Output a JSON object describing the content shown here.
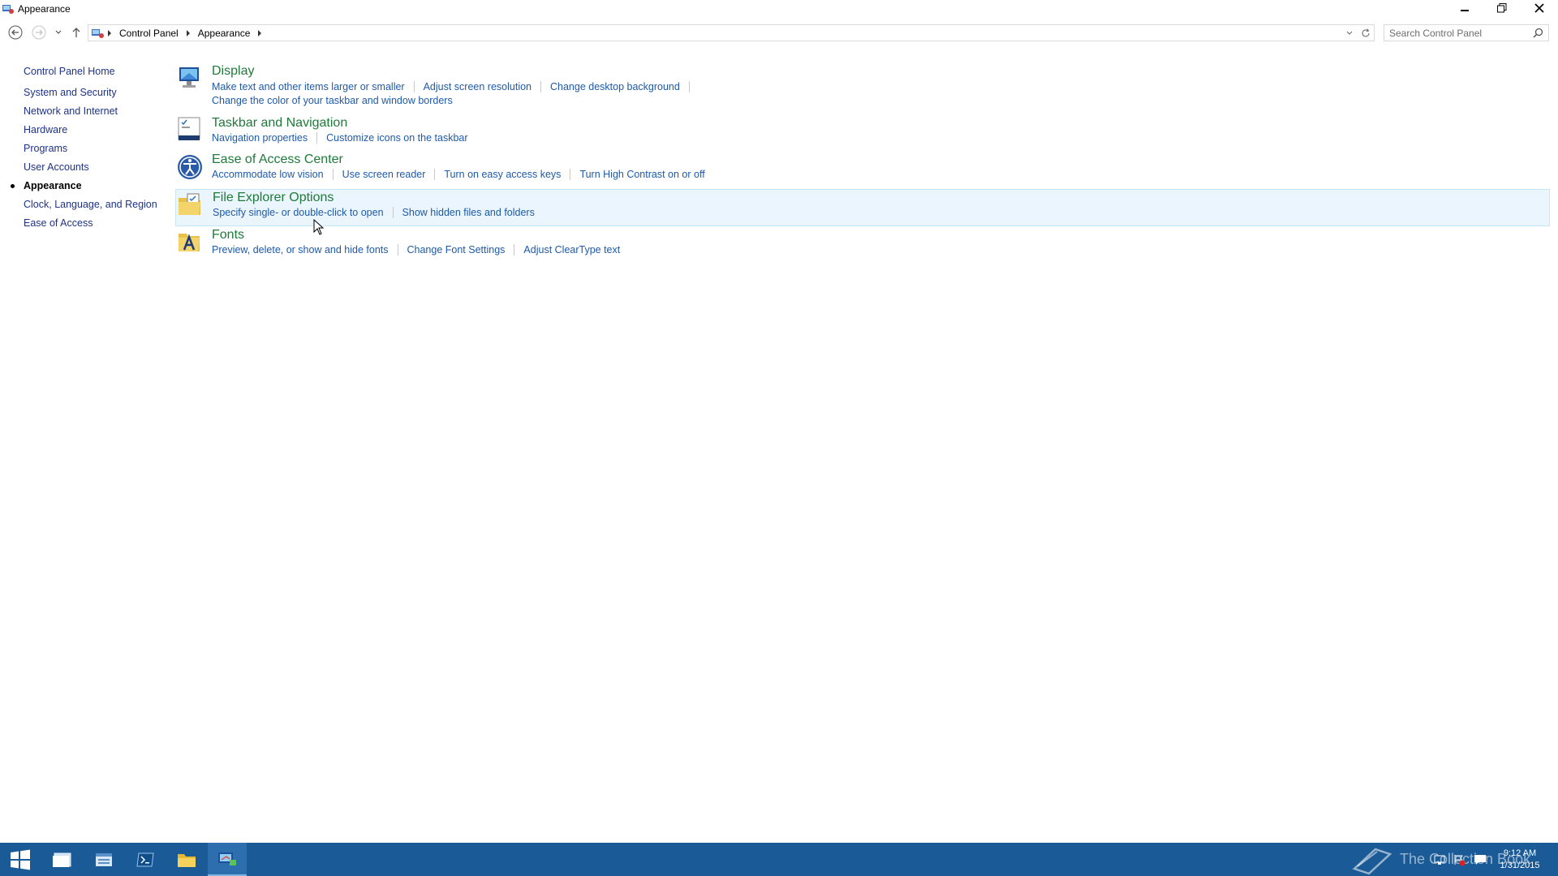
{
  "window": {
    "title": "Appearance",
    "minimize_icon": "minimize-icon",
    "restore_icon": "restore-icon",
    "close_icon": "close-icon"
  },
  "address": {
    "breadcrumbs": [
      "Control Panel",
      "Appearance"
    ],
    "search_placeholder": "Search Control Panel"
  },
  "sidebar": {
    "home": "Control Panel Home",
    "items": [
      {
        "label": "System and Security"
      },
      {
        "label": "Network and Internet"
      },
      {
        "label": "Hardware"
      },
      {
        "label": "Programs"
      },
      {
        "label": "User Accounts"
      },
      {
        "label": "Appearance",
        "active": true
      },
      {
        "label": "Clock, Language, and Region"
      },
      {
        "label": "Ease of Access"
      }
    ]
  },
  "categories": [
    {
      "title": "Display",
      "icon": "display-icon",
      "links_row1": [
        "Make text and other items larger or smaller",
        "Adjust screen resolution",
        "Change desktop background"
      ],
      "links_row2": [
        "Change the color of your taskbar and window borders"
      ]
    },
    {
      "title": "Taskbar and Navigation",
      "icon": "taskbar-icon",
      "links_row1": [
        "Navigation properties",
        "Customize icons on the taskbar"
      ]
    },
    {
      "title": "Ease of Access Center",
      "icon": "ease-of-access-icon",
      "links_row1": [
        "Accommodate low vision",
        "Use screen reader",
        "Turn on easy access keys",
        "Turn High Contrast on or off"
      ]
    },
    {
      "title": "File Explorer Options",
      "icon": "folder-options-icon",
      "links_row1": [
        "Specify single- or double-click to open",
        "Show hidden files and folders"
      ]
    },
    {
      "title": "Fonts",
      "icon": "fonts-icon",
      "links_row1": [
        "Preview, delete, or show and hide fonts",
        "Change Font Settings",
        "Adjust ClearType text"
      ]
    }
  ],
  "taskbar": {
    "time": "9:12 AM",
    "date": "1/31/2015",
    "watermark": "The Collection Book",
    "colors": {
      "bar": "#1a5a96",
      "active": "#2d6fae"
    }
  },
  "colors": {
    "category_title": "#1f7a3a",
    "link": "#1e5aa8",
    "sidebar_link": "#1e3287",
    "hover_bg": "#eaf5fd"
  }
}
